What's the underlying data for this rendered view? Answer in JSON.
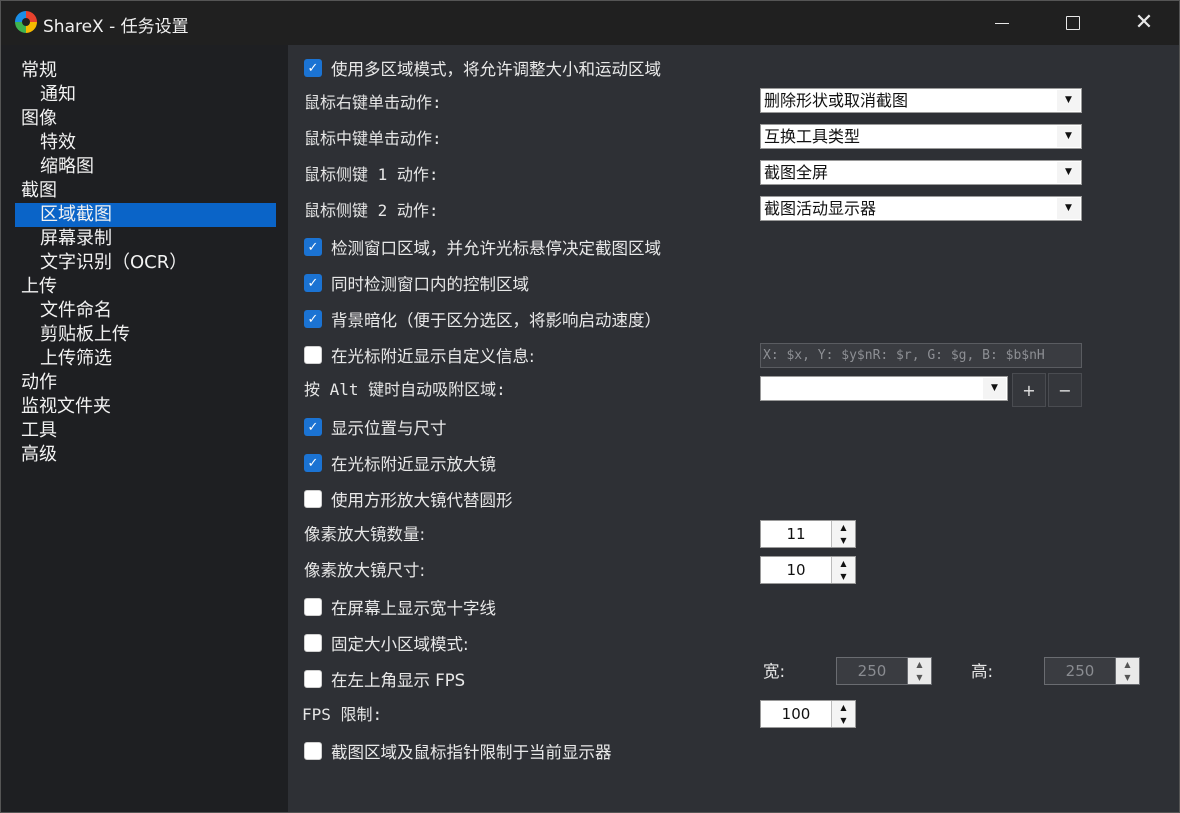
{
  "window": {
    "title": "ShareX - 任务设置",
    "min_icon": "minimize-icon",
    "max_icon": "maximize-icon",
    "close_icon": "close-icon"
  },
  "sidebar": {
    "items": [
      {
        "label": "常规",
        "level": 0
      },
      {
        "label": "通知",
        "level": 1
      },
      {
        "label": "图像",
        "level": 0
      },
      {
        "label": "特效",
        "level": 1
      },
      {
        "label": "缩略图",
        "level": 1
      },
      {
        "label": "截图",
        "level": 0
      },
      {
        "label": "区域截图",
        "level": 1,
        "selected": true
      },
      {
        "label": "屏幕录制",
        "level": 1
      },
      {
        "label": "文字识别（OCR）",
        "level": 1
      },
      {
        "label": "上传",
        "level": 0
      },
      {
        "label": "文件命名",
        "level": 1
      },
      {
        "label": "剪贴板上传",
        "level": 1
      },
      {
        "label": "上传筛选",
        "level": 1
      },
      {
        "label": "动作",
        "level": 0
      },
      {
        "label": "监视文件夹",
        "level": 0
      },
      {
        "label": "工具",
        "level": 0
      },
      {
        "label": "高级",
        "level": 0
      }
    ]
  },
  "settings": {
    "multi_region": {
      "label": "使用多区域模式，将允许调整大小和运动区域",
      "checked": true
    },
    "right_click": {
      "label": "鼠标右键单击动作:",
      "value": "删除形状或取消截图"
    },
    "middle_click": {
      "label": "鼠标中键单击动作:",
      "value": "互换工具类型"
    },
    "side_key1": {
      "label": "鼠标侧键 1 动作:",
      "value": "截图全屏"
    },
    "side_key2": {
      "label": "鼠标侧键 2 动作:",
      "value": "截图活动显示器"
    },
    "detect_windows": {
      "label": "检测窗口区域，并允许光标悬停决定截图区域",
      "checked": true
    },
    "detect_controls": {
      "label": "同时检测窗口内的控制区域",
      "checked": true
    },
    "dim_background": {
      "label": "背景暗化（便于区分选区，将影响启动速度）",
      "checked": true
    },
    "custom_info": {
      "label": "在光标附近显示自定义信息:",
      "checked": false,
      "value": "X: $x, Y: $y$nR: $r, G: $g, B: $b$nH"
    },
    "alt_snap": {
      "label": "按 Alt 键时自动吸附区域:",
      "value": "",
      "add_label": "+",
      "remove_label": "−"
    },
    "show_position": {
      "label": "显示位置与尺寸",
      "checked": true
    },
    "show_magnifier": {
      "label": "在光标附近显示放大镜",
      "checked": true
    },
    "square_magnifier": {
      "label": "使用方形放大镜代替圆形",
      "checked": false
    },
    "magnifier_count": {
      "label": "像素放大镜数量:",
      "value": "11"
    },
    "magnifier_size": {
      "label": "像素放大镜尺寸:",
      "value": "10"
    },
    "crosshair": {
      "label": "在屏幕上显示宽十字线",
      "checked": false
    },
    "fixed_size": {
      "label": "固定大小区域模式:",
      "checked": false
    },
    "width": {
      "label": "宽:",
      "value": "250"
    },
    "height": {
      "label": "高:",
      "value": "250"
    },
    "show_fps": {
      "label": "在左上角显示 FPS",
      "checked": false
    },
    "fps_limit": {
      "label": "FPS 限制:",
      "value": "100"
    },
    "limit_monitor": {
      "label": "截图区域及鼠标指针限制于当前显示器",
      "checked": false
    }
  }
}
